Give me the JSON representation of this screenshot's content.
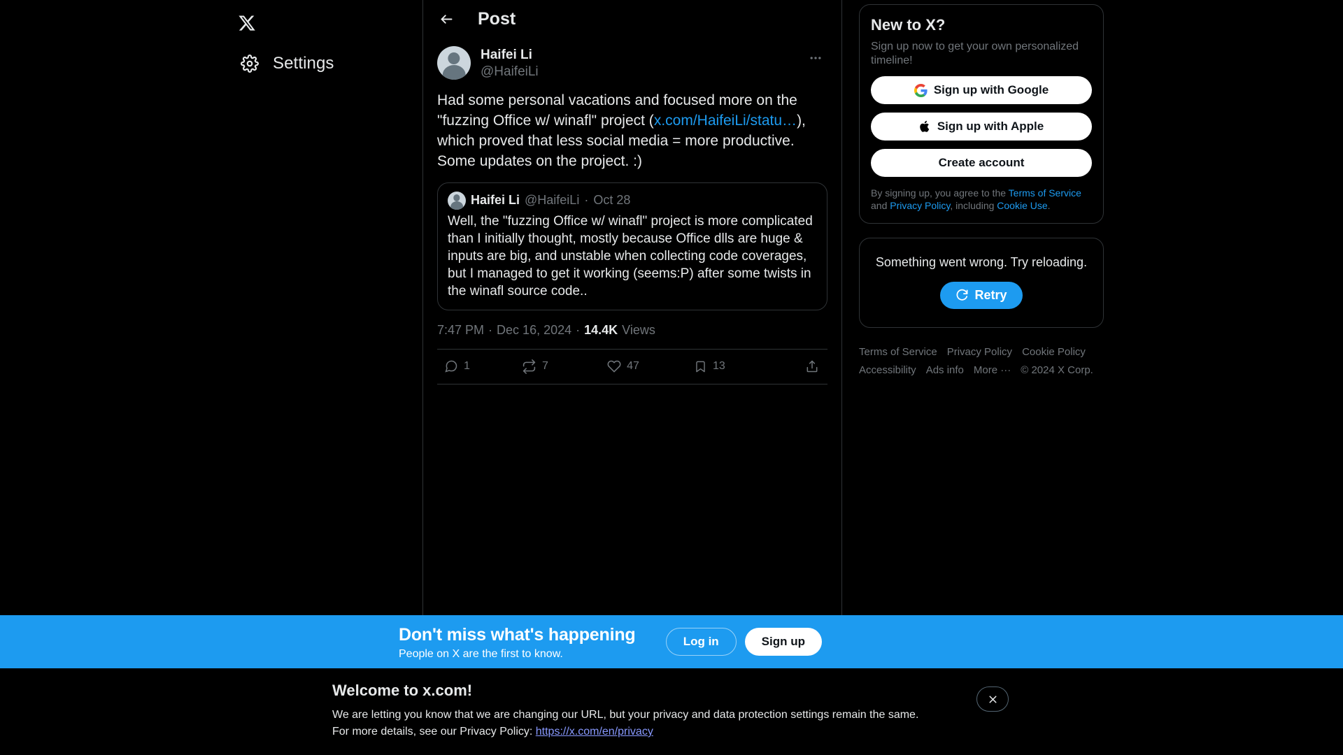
{
  "sidebar": {
    "logo_icon": "x-logo-icon",
    "items": [
      {
        "label": "Settings",
        "icon": "gear-icon"
      }
    ]
  },
  "center": {
    "header": {
      "title": "Post",
      "back_icon": "back-arrow-icon"
    },
    "post": {
      "display_name": "Haifei Li",
      "handle": "@HaifeiLi",
      "more_icon": "more-horizontal-icon",
      "body_part1": "Had some personal vacations and focused more on the \"fuzzing Office w/ winafl\" project (",
      "body_link": "x.com/HaifeiLi/statu…",
      "body_part2": "), which proved that less social media = more productive. Some updates on the project. :)",
      "quote": {
        "display_name": "Haifei Li",
        "handle": "@HaifeiLi",
        "separator": "·",
        "date": "Oct 28",
        "body": "Well, the \"fuzzing Office w/ winafl\" project is more complicated than I initially thought, mostly because Office dlls are huge & inputs are big, and unstable when collecting code coverages, but I managed to get it working (seems:P) after some twists in the winafl source code.."
      },
      "meta": {
        "time": "7:47 PM",
        "sep1": "·",
        "date": "Dec 16, 2024",
        "sep2": "·",
        "views_count": "14.4K",
        "views_label": "Views"
      },
      "actions": {
        "reply": {
          "icon": "reply-icon",
          "count": "1"
        },
        "repost": {
          "icon": "repost-icon",
          "count": "7"
        },
        "like": {
          "icon": "heart-icon",
          "count": "47"
        },
        "bookmark": {
          "icon": "bookmark-icon",
          "count": "13"
        },
        "share": {
          "icon": "share-icon",
          "count": ""
        }
      }
    }
  },
  "right": {
    "signup_card": {
      "title": "New to X?",
      "subtitle": "Sign up now to get your own personalized timeline!",
      "google_button": "Sign up with Google",
      "apple_button": "Sign up with Apple",
      "create_button": "Create account",
      "legal_prefix": "By signing up, you agree to the ",
      "legal_tos": "Terms of Service",
      "legal_and": " and ",
      "legal_privacy": "Privacy Policy",
      "legal_including": ", including ",
      "legal_cookie": "Cookie Use",
      "legal_end": "."
    },
    "error_card": {
      "message": "Something went wrong. Try reloading.",
      "retry_label": "Retry",
      "retry_icon": "refresh-icon"
    },
    "footer_links": [
      "Terms of Service",
      "Privacy Policy",
      "Cookie Policy",
      "Accessibility",
      "Ads info",
      "More ···",
      "© 2024 X Corp."
    ]
  },
  "banner": {
    "heading": "Don't miss what's happening",
    "subheading": "People on X are the first to know.",
    "login_label": "Log in",
    "signup_label": "Sign up"
  },
  "notice": {
    "heading": "Welcome to x.com!",
    "line1": "We are letting you know that we are changing our URL, but your privacy and data protection settings remain the same.",
    "line2_prefix": "For more details, see our Privacy Policy: ",
    "line2_link": "https://x.com/en/privacy",
    "close_icon": "close-icon"
  },
  "colors": {
    "accent": "#1d9bf0",
    "background": "#000000",
    "text": "#e7e9ea",
    "muted": "#71767b",
    "border": "#2f3336"
  }
}
